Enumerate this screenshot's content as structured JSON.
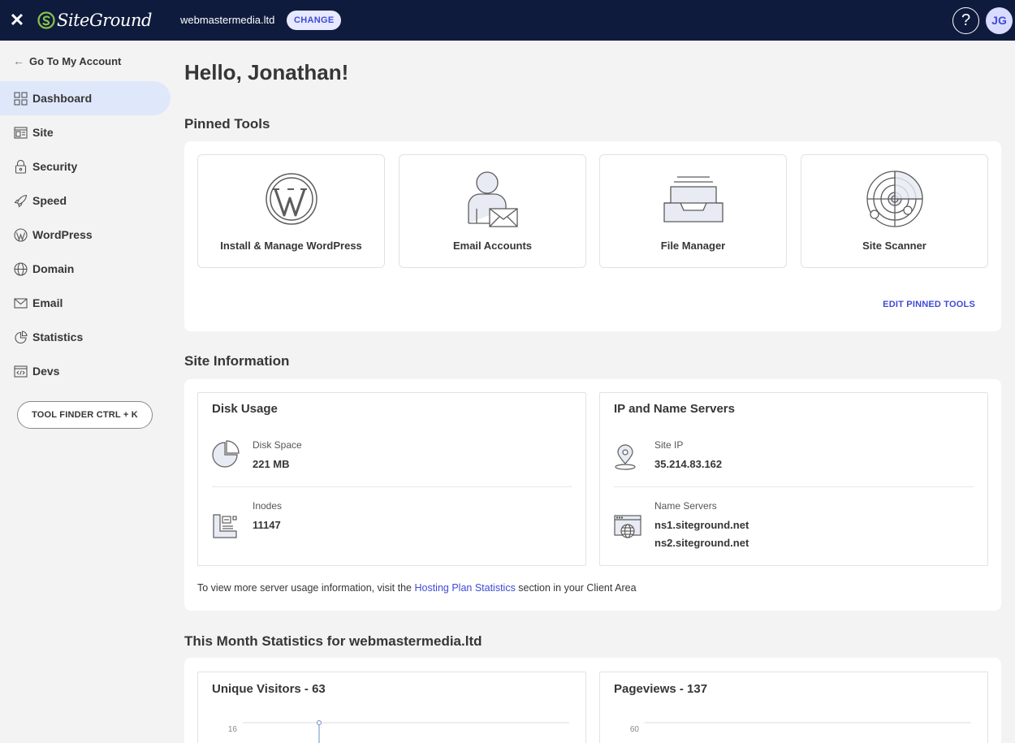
{
  "header": {
    "logo_text": "SiteGround",
    "domain": "webmastermedia.ltd",
    "change_label": "CHANGE",
    "help_label": "?",
    "avatar_initials": "JG"
  },
  "sidebar": {
    "back_label": "Go To My Account",
    "items": [
      {
        "label": "Dashboard",
        "icon": "grid-icon",
        "active": true
      },
      {
        "label": "Site",
        "icon": "site-icon"
      },
      {
        "label": "Security",
        "icon": "lock-icon"
      },
      {
        "label": "Speed",
        "icon": "rocket-icon"
      },
      {
        "label": "WordPress",
        "icon": "wordpress-icon"
      },
      {
        "label": "Domain",
        "icon": "globe-icon"
      },
      {
        "label": "Email",
        "icon": "envelope-icon"
      },
      {
        "label": "Statistics",
        "icon": "pie-chart-icon"
      },
      {
        "label": "Devs",
        "icon": "code-icon"
      }
    ],
    "tool_finder_label": "TOOL FINDER CTRL + K"
  },
  "main": {
    "greeting": "Hello, Jonathan!",
    "pinned_tools": {
      "title": "Pinned Tools",
      "tools": [
        {
          "label": "Install & Manage WordPress",
          "icon": "wordpress-logo-icon"
        },
        {
          "label": "Email Accounts",
          "icon": "email-accounts-icon"
        },
        {
          "label": "File Manager",
          "icon": "file-tray-icon"
        },
        {
          "label": "Site Scanner",
          "icon": "radar-icon"
        }
      ],
      "edit_label": "EDIT PINNED TOOLS"
    },
    "site_information": {
      "title": "Site Information",
      "disk_usage": {
        "title": "Disk Usage",
        "disk_space_label": "Disk Space",
        "disk_space_value": "221 MB",
        "inodes_label": "Inodes",
        "inodes_value": "11147"
      },
      "ip_name_servers": {
        "title": "IP and Name Servers",
        "site_ip_label": "Site IP",
        "site_ip_value": "35.214.83.162",
        "name_servers_label": "Name Servers",
        "ns1": "ns1.siteground.net",
        "ns2": "ns2.siteground.net"
      },
      "note_before": "To view more server usage information, visit the ",
      "note_link": "Hosting Plan Statistics",
      "note_after": " section in your Client Area"
    },
    "statistics": {
      "title": "This Month Statistics for webmastermedia.ltd",
      "unique_visitors_title": "Unique Visitors - 63",
      "unique_visitors_axis_top": "16",
      "pageviews_title": "Pageviews - 137",
      "pageviews_axis_top": "60"
    }
  },
  "colors": {
    "topbar": "#0f1b3d",
    "accent": "#3f4ad6",
    "active_nav": "#dfe8fb",
    "logo_green": "#8bc34a"
  }
}
